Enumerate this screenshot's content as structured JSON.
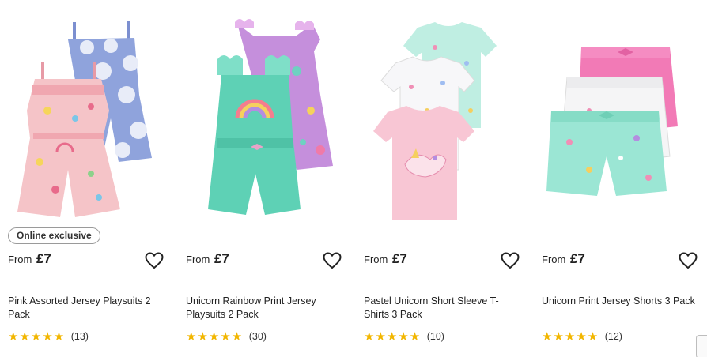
{
  "colors": {
    "star": "#f2b600",
    "text": "#222222",
    "badge_border": "#9a9a9a"
  },
  "products": [
    {
      "image_name": "pink-playsuits-image",
      "badge": "Online exclusive",
      "price_prefix": "From",
      "price": "£7",
      "title": "Pink Assorted Jersey Playsuits 2 Pack",
      "rating_value": 5,
      "review_count": "(13)"
    },
    {
      "image_name": "unicorn-rainbow-playsuits-image",
      "badge": "",
      "price_prefix": "From",
      "price": "£7",
      "title": "Unicorn Rainbow Print Jersey Playsuits 2 Pack",
      "rating_value": 5,
      "review_count": "(30)"
    },
    {
      "image_name": "pastel-unicorn-tshirts-image",
      "badge": "",
      "price_prefix": "From",
      "price": "£7",
      "title": "Pastel Unicorn Short Sleeve T-Shirts 3 Pack",
      "rating_value": 5,
      "review_count": "(10)"
    },
    {
      "image_name": "unicorn-shorts-image",
      "badge": "",
      "price_prefix": "From",
      "price": "£7",
      "title": "Unicorn Print Jersey Shorts 3 Pack",
      "rating_value": 5,
      "review_count": "(12)"
    }
  ],
  "icons": {
    "wishlist": "heart-outline-icon",
    "rating": "star-icon"
  }
}
